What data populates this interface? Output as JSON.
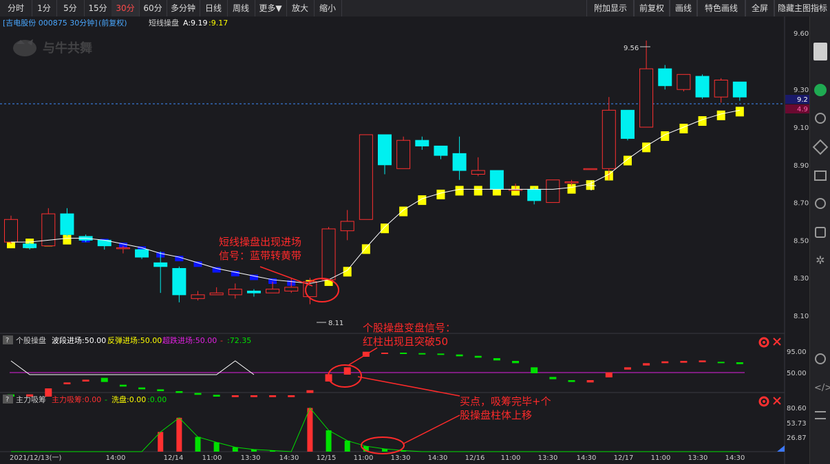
{
  "toolbar": {
    "left": [
      "分时",
      "1分",
      "5分",
      "15分",
      "30分",
      "60分",
      "多分钟",
      "日线",
      "周线",
      "更多▼",
      "放大",
      "缩小"
    ],
    "active": "30分",
    "right": [
      "附加显示",
      "前复权",
      "画线",
      "特色画线",
      "全屏",
      "隐藏主图指标"
    ]
  },
  "info_bar": {
    "stock": "[吉电股份 000875 30分钟]",
    "adjust": "(前复权)",
    "indicator": "短线操盘",
    "a_value": "A:9.19",
    "b_value": ":9.17",
    "watermark": "与牛共舞"
  },
  "price_axis": {
    "labels": [
      "9.60",
      "9.30",
      "9.10",
      "8.90",
      "8.70",
      "8.50",
      "8.30",
      "8.10"
    ],
    "ref_price": "9.2",
    "ref_pct": "4.9"
  },
  "annotations": {
    "high": "9.56",
    "low": "8.11",
    "signal1_line1": "短线操盘出现进场",
    "signal1_line2": "信号：蓝带转黄带",
    "signal2_line1": "个股操盘变盘信号：",
    "signal2_line2": "红柱出现且突破50",
    "signal3_line1": "买点，吸筹完毕+个",
    "signal3_line2": "股操盘柱体上移"
  },
  "panel2": {
    "q": "?",
    "name": "个股操盘",
    "item1": "波段进场:50.00",
    "item2": "反弹进场:50.00",
    "item3": "超跌进场:50.00",
    "item4": ":72.35",
    "axis": [
      "95.00",
      "50.00"
    ]
  },
  "panel3": {
    "q": "?",
    "name": "主力吸筹",
    "item1": "主力吸筹:0.00",
    "item2": "洗盘:0.00",
    "item3": ":0.00",
    "axis": [
      "80.60",
      "53.73",
      "26.87"
    ]
  },
  "time_axis": [
    "2021/12/13(一)",
    "14:00",
    "12/14",
    "11:00",
    "13:30",
    "14:30",
    "12/15",
    "11:00",
    "13:30",
    "14:30",
    "12/16",
    "11:00",
    "13:30",
    "14:30",
    "12/17",
    "11:00",
    "13:30",
    "14:30"
  ],
  "colors": {
    "up": "#ff3030",
    "down": "#00f0f0",
    "yellow": "#ffff00",
    "blue": "#0a14ff",
    "magenta": "#e020e0",
    "green": "#00e000",
    "annot": "#ff2a2a"
  },
  "chart_data": {
    "type": "candlestick",
    "ylim": [
      8.08,
      9.63
    ],
    "candles": [
      {
        "o": 8.49,
        "c": 8.61,
        "h": 8.63,
        "l": 8.48
      },
      {
        "o": 8.48,
        "c": 8.46,
        "h": 8.49,
        "l": 8.45
      },
      {
        "o": 8.47,
        "c": 8.64,
        "h": 8.67,
        "l": 8.47
      },
      {
        "o": 8.64,
        "c": 8.53,
        "h": 8.67,
        "l": 8.52
      },
      {
        "o": 8.52,
        "c": 8.5,
        "h": 8.53,
        "l": 8.49
      },
      {
        "o": 8.5,
        "c": 8.47,
        "h": 8.5,
        "l": 8.45
      },
      {
        "o": 8.46,
        "c": 8.46,
        "h": 8.47,
        "l": 8.43
      },
      {
        "o": 8.45,
        "c": 8.41,
        "h": 8.45,
        "l": 8.4
      },
      {
        "o": 8.38,
        "c": 8.36,
        "h": 8.44,
        "l": 8.22
      },
      {
        "o": 8.35,
        "c": 8.21,
        "h": 8.36,
        "l": 8.17
      },
      {
        "o": 8.19,
        "c": 8.21,
        "h": 8.23,
        "l": 8.18
      },
      {
        "o": 8.21,
        "c": 8.22,
        "h": 8.25,
        "l": 8.21
      },
      {
        "o": 8.21,
        "c": 8.24,
        "h": 8.27,
        "l": 8.19
      },
      {
        "o": 8.23,
        "c": 8.22,
        "h": 8.24,
        "l": 8.2
      },
      {
        "o": 8.22,
        "c": 8.24,
        "h": 8.28,
        "l": 8.22
      },
      {
        "o": 8.23,
        "c": 8.25,
        "h": 8.3,
        "l": 8.22
      },
      {
        "o": 8.2,
        "c": 8.28,
        "h": 8.3,
        "l": 8.16
      },
      {
        "o": 8.29,
        "c": 8.56,
        "h": 8.57,
        "l": 8.29
      },
      {
        "o": 8.55,
        "c": 8.6,
        "h": 8.66,
        "l": 8.5
      },
      {
        "o": 8.61,
        "c": 9.06,
        "h": 9.06,
        "l": 8.61
      },
      {
        "o": 9.06,
        "c": 8.9,
        "h": 9.06,
        "l": 8.85
      },
      {
        "o": 8.88,
        "c": 9.03,
        "h": 9.05,
        "l": 8.88
      },
      {
        "o": 9.03,
        "c": 9.0,
        "h": 9.05,
        "l": 8.98
      },
      {
        "o": 9.0,
        "c": 8.95,
        "h": 9.0,
        "l": 8.93
      },
      {
        "o": 8.96,
        "c": 8.87,
        "h": 9.05,
        "l": 8.82
      },
      {
        "o": 8.85,
        "c": 8.87,
        "h": 8.94,
        "l": 8.84
      },
      {
        "o": 8.87,
        "c": 8.77,
        "h": 8.87,
        "l": 8.77
      },
      {
        "o": 8.77,
        "c": 8.77,
        "h": 8.8,
        "l": 8.77
      },
      {
        "o": 8.77,
        "c": 8.71,
        "h": 8.78,
        "l": 8.69
      },
      {
        "o": 8.7,
        "c": 8.82,
        "h": 8.82,
        "l": 8.7
      },
      {
        "o": 8.81,
        "c": 8.81,
        "h": 8.82,
        "l": 8.79
      },
      {
        "o": 8.88,
        "c": 8.88,
        "h": 8.88,
        "l": 8.88
      },
      {
        "o": 8.88,
        "c": 9.19,
        "h": 9.26,
        "l": 8.82
      },
      {
        "o": 9.19,
        "c": 9.04,
        "h": 9.19,
        "l": 9.03
      },
      {
        "o": 9.1,
        "c": 9.41,
        "h": 9.56,
        "l": 9.1
      },
      {
        "o": 9.41,
        "c": 9.32,
        "h": 9.43,
        "l": 9.3
      },
      {
        "o": 9.3,
        "c": 9.38,
        "h": 9.38,
        "l": 9.29
      },
      {
        "o": 9.37,
        "c": 9.26,
        "h": 9.38,
        "l": 9.25
      },
      {
        "o": 9.26,
        "c": 9.35,
        "h": 9.36,
        "l": 9.23
      },
      {
        "o": 9.34,
        "c": 9.26,
        "h": 9.34,
        "l": 9.24
      }
    ],
    "ma": [
      8.49,
      8.49,
      8.5,
      8.51,
      8.51,
      8.5,
      8.48,
      8.46,
      8.43,
      8.41,
      8.38,
      8.35,
      8.33,
      8.31,
      8.29,
      8.28,
      8.27,
      8.29,
      8.34,
      8.46,
      8.57,
      8.66,
      8.72,
      8.75,
      8.77,
      8.77,
      8.77,
      8.77,
      8.77,
      8.77,
      8.78,
      8.8,
      8.85,
      8.93,
      9.0,
      9.06,
      9.1,
      9.14,
      9.17,
      9.19
    ],
    "band_color": [
      "yellow",
      "yellow",
      "yellow",
      "yellow",
      "blue",
      "blue",
      "blue",
      "blue",
      "blue",
      "blue",
      "blue",
      "blue",
      "blue",
      "blue",
      "blue",
      "blue",
      "yellow",
      "yellow",
      "yellow",
      "yellow",
      "yellow",
      "yellow",
      "yellow",
      "yellow",
      "yellow",
      "yellow",
      "yellow",
      "yellow",
      "yellow",
      "yellow",
      "yellow",
      "yellow",
      "yellow",
      "yellow",
      "yellow",
      "yellow",
      "yellow",
      "yellow",
      "yellow",
      "yellow"
    ],
    "panel2_bars": [
      {
        "c": "green",
        "b": 2,
        "t": 7
      },
      {
        "c": "red",
        "b": 2,
        "t": 7
      },
      {
        "c": "red",
        "b": 2,
        "t": 20
      },
      {
        "c": "red",
        "b": 29,
        "t": 33
      },
      {
        "c": "red",
        "b": 35,
        "t": 39
      },
      {
        "c": "green",
        "b": 34,
        "t": 43
      },
      {
        "c": "green",
        "b": 24,
        "t": 28
      },
      {
        "c": "green",
        "b": 18,
        "t": 22
      },
      {
        "c": "green",
        "b": 14,
        "t": 18
      },
      {
        "c": "green",
        "b": 10,
        "t": 14
      },
      {
        "c": "green",
        "b": 6,
        "t": 10
      },
      {
        "c": "green",
        "b": 2,
        "t": 6
      },
      {
        "c": "red",
        "b": 1,
        "t": 5
      },
      {
        "c": "red",
        "b": 1,
        "t": 5
      },
      {
        "c": "red",
        "b": 1,
        "t": 5
      },
      {
        "c": "red",
        "b": 1,
        "t": 5
      },
      {
        "c": "red",
        "b": 10,
        "t": 16
      },
      {
        "c": "red",
        "b": 35,
        "t": 51
      },
      {
        "c": "red",
        "b": 50,
        "t": 66
      },
      {
        "c": "red",
        "b": 89,
        "t": 100
      },
      {
        "c": "red",
        "b": 96,
        "t": 98
      },
      {
        "c": "green",
        "b": 96,
        "t": 98
      },
      {
        "c": "green",
        "b": 94,
        "t": 97
      },
      {
        "c": "green",
        "b": 93,
        "t": 96
      },
      {
        "c": "green",
        "b": 90,
        "t": 94
      },
      {
        "c": "green",
        "b": 87,
        "t": 91
      },
      {
        "c": "green",
        "b": 81,
        "t": 86
      },
      {
        "c": "green",
        "b": 75,
        "t": 80
      },
      {
        "c": "green",
        "b": 53,
        "t": 66
      },
      {
        "c": "green",
        "b": 40,
        "t": 45
      },
      {
        "c": "green",
        "b": 34,
        "t": 38
      },
      {
        "c": "red",
        "b": 33,
        "t": 38
      },
      {
        "c": "red",
        "b": 44,
        "t": 55
      },
      {
        "c": "red",
        "b": 61,
        "t": 66
      },
      {
        "c": "red",
        "b": 70,
        "t": 75
      },
      {
        "c": "red",
        "b": 75,
        "t": 79
      },
      {
        "c": "red",
        "b": 76,
        "t": 80
      },
      {
        "c": "red",
        "b": 77,
        "t": 81
      },
      {
        "c": "green",
        "b": 75,
        "t": 78
      },
      {
        "c": "green",
        "b": 73,
        "t": 77
      }
    ],
    "panel2_line": [
      80,
      50,
      50,
      50,
      50,
      50,
      50,
      50,
      50,
      50,
      50,
      50,
      80,
      50,
      50,
      50,
      50,
      50,
      75,
      95,
      95,
      95,
      95,
      95,
      95,
      95,
      95,
      95,
      95,
      95,
      95,
      95,
      95,
      95,
      95,
      95,
      95,
      95,
      95,
      95
    ],
    "panel3_bars": [
      {
        "c": "red",
        "v": 0
      },
      {
        "c": "red",
        "v": 0
      },
      {
        "c": "red",
        "v": 0
      },
      {
        "c": "red",
        "v": 0
      },
      {
        "c": "red",
        "v": 0
      },
      {
        "c": "red",
        "v": 0
      },
      {
        "c": "red",
        "v": 0
      },
      {
        "c": "red",
        "v": 0
      },
      {
        "c": "red",
        "v": 36
      },
      {
        "c": "red",
        "v": 62
      },
      {
        "c": "green",
        "v": 27
      },
      {
        "c": "green",
        "v": 17
      },
      {
        "c": "green",
        "v": 8
      },
      {
        "c": "green",
        "v": 4
      },
      {
        "c": "green",
        "v": 2
      },
      {
        "c": "green",
        "v": 0
      },
      {
        "c": "red",
        "v": 80
      },
      {
        "c": "green",
        "v": 39
      },
      {
        "c": "green",
        "v": 20
      },
      {
        "c": "green",
        "v": 10
      },
      {
        "c": "green",
        "v": 5
      },
      {
        "c": "green",
        "v": 2
      },
      {
        "c": "green",
        "v": 0
      },
      {
        "c": "green",
        "v": 0
      },
      {
        "c": "green",
        "v": 0
      },
      {
        "c": "green",
        "v": 0
      },
      {
        "c": "green",
        "v": 0
      },
      {
        "c": "green",
        "v": 0
      },
      {
        "c": "green",
        "v": 0
      },
      {
        "c": "green",
        "v": 0
      },
      {
        "c": "green",
        "v": 0
      },
      {
        "c": "green",
        "v": 0
      },
      {
        "c": "green",
        "v": 0
      },
      {
        "c": "green",
        "v": 0
      },
      {
        "c": "green",
        "v": 0
      },
      {
        "c": "green",
        "v": 0
      },
      {
        "c": "green",
        "v": 0
      },
      {
        "c": "green",
        "v": 0
      },
      {
        "c": "green",
        "v": 0
      },
      {
        "c": "green",
        "v": 0
      }
    ]
  }
}
